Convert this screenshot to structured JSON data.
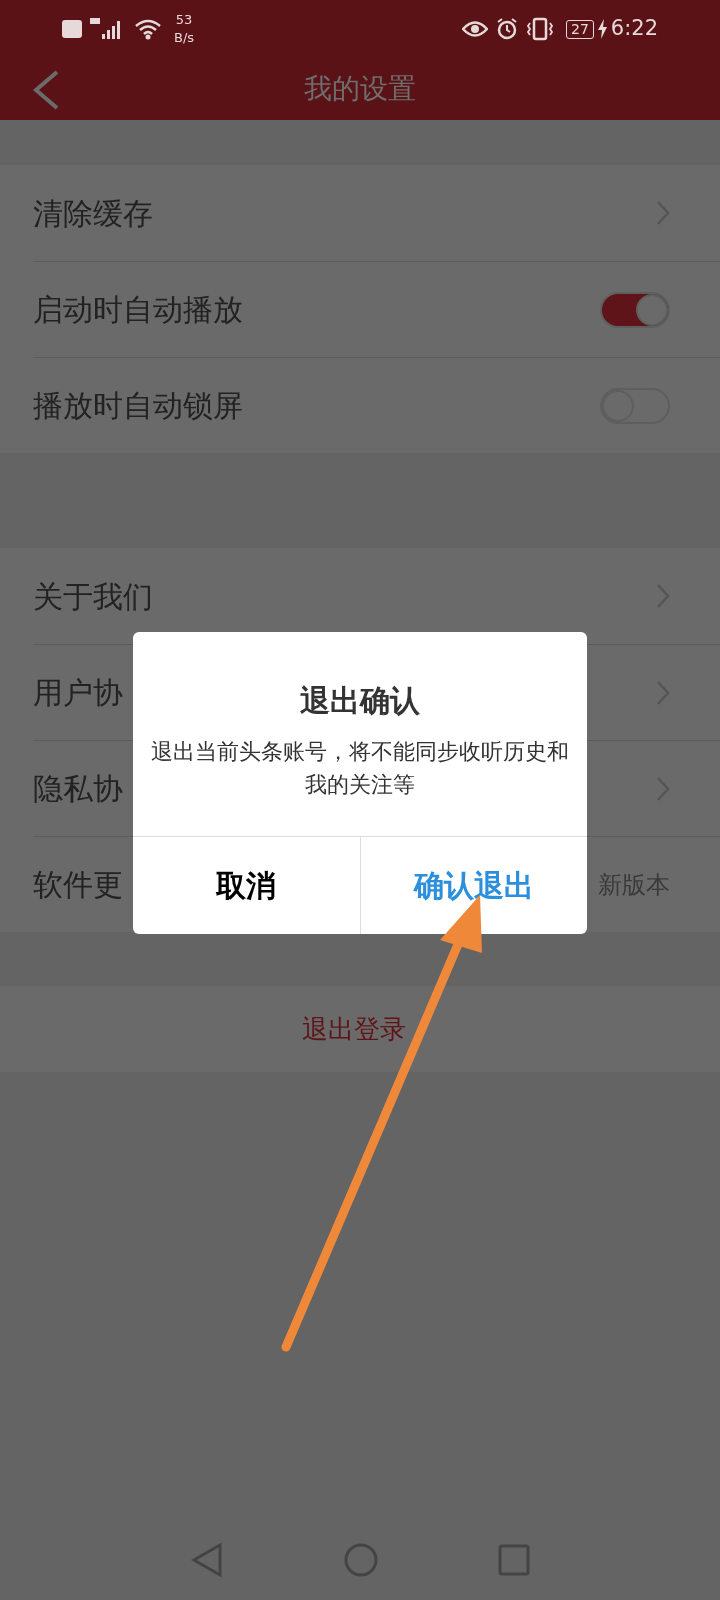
{
  "status_bar": {
    "net_speed": "53",
    "net_unit": "B/s",
    "battery": "27",
    "time": "6:22"
  },
  "header": {
    "title": "我的设置"
  },
  "sections": [
    {
      "items": [
        {
          "label": "清除缓存",
          "kind": "link"
        },
        {
          "label": "启动时自动播放",
          "kind": "toggle",
          "on": true
        },
        {
          "label": "播放时自动锁屏",
          "kind": "toggle",
          "on": false
        }
      ]
    },
    {
      "items": [
        {
          "label": "关于我们",
          "kind": "link"
        },
        {
          "label": "用户协",
          "kind": "link"
        },
        {
          "label": "隐私协",
          "kind": "link"
        },
        {
          "label": "软件更",
          "kind": "value",
          "value": "新版本"
        }
      ]
    }
  ],
  "logout": {
    "label": "退出登录"
  },
  "dialog": {
    "title": "退出确认",
    "message": "退出当前头条账号，将不能同步收听历史和我的关注等",
    "buttons": [
      {
        "label": "取消",
        "kind": "cancel"
      },
      {
        "label": "确认退出",
        "kind": "confirm"
      }
    ]
  }
}
